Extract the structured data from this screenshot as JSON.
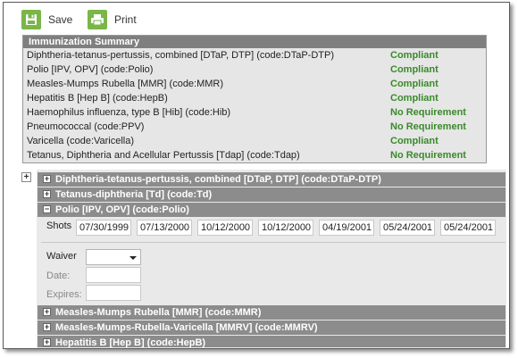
{
  "toolbar": {
    "save_label": "Save",
    "print_label": "Print"
  },
  "summary": {
    "title": "Immunization Summary",
    "rows": [
      {
        "vaccine": "Diphtheria-tetanus-pertussis, combined [DTaP, DTP] (code:DTaP-DTP)",
        "status": "Compliant"
      },
      {
        "vaccine": "Polio [IPV, OPV] (code:Polio)",
        "status": "Compliant"
      },
      {
        "vaccine": "Measles-Mumps Rubella [MMR] (code:MMR)",
        "status": "Compliant"
      },
      {
        "vaccine": "Hepatitis B [Hep B] (code:HepB)",
        "status": "Compliant"
      },
      {
        "vaccine": "Haemophilus influenza, type B [Hib] (code:Hib)",
        "status": "No Requirement"
      },
      {
        "vaccine": "Pneumococcal (code:PPV)",
        "status": "No Requirement"
      },
      {
        "vaccine": "Varicella (code:Varicella)",
        "status": "Compliant"
      },
      {
        "vaccine": "Tetanus, Diphtheria and Acellular Pertussis [Tdap] (code:Tdap)",
        "status": "No Requirement"
      }
    ]
  },
  "accordion": {
    "toggle_all_symbol": "+",
    "sections": [
      {
        "symbol": "+",
        "label": "Diphtheria-tetanus-pertussis, combined [DTaP, DTP] (code:DTaP-DTP)"
      },
      {
        "symbol": "+",
        "label": "Tetanus-diphtheria [Td] (code:Td)"
      },
      {
        "symbol": "−",
        "label": "Polio [IPV, OPV] (code:Polio)"
      },
      {
        "symbol": "+",
        "label": "Measles-Mumps Rubella [MMR] (code:MMR)"
      },
      {
        "symbol": "+",
        "label": "Measles-Mumps-Rubella-Varicella [MMRV] (code:MMRV)"
      },
      {
        "symbol": "+",
        "label": "Hepatitis B [Hep B] (code:HepB)"
      }
    ]
  },
  "polio_detail": {
    "shots_label": "Shots",
    "shots": [
      "07/30/1999",
      "07/13/2000",
      "10/12/2000",
      "10/12/2000",
      "04/19/2001",
      "05/24/2001",
      "05/24/2001"
    ],
    "waiver_label": "Waiver",
    "waiver_value": "",
    "date_label": "Date:",
    "expires_label": "Expires:"
  },
  "colors": {
    "accent_green": "#7ab648",
    "status_green": "#3a8a2a",
    "summary_header": "#7f7f7f",
    "section_header": "#8c8c8c"
  }
}
